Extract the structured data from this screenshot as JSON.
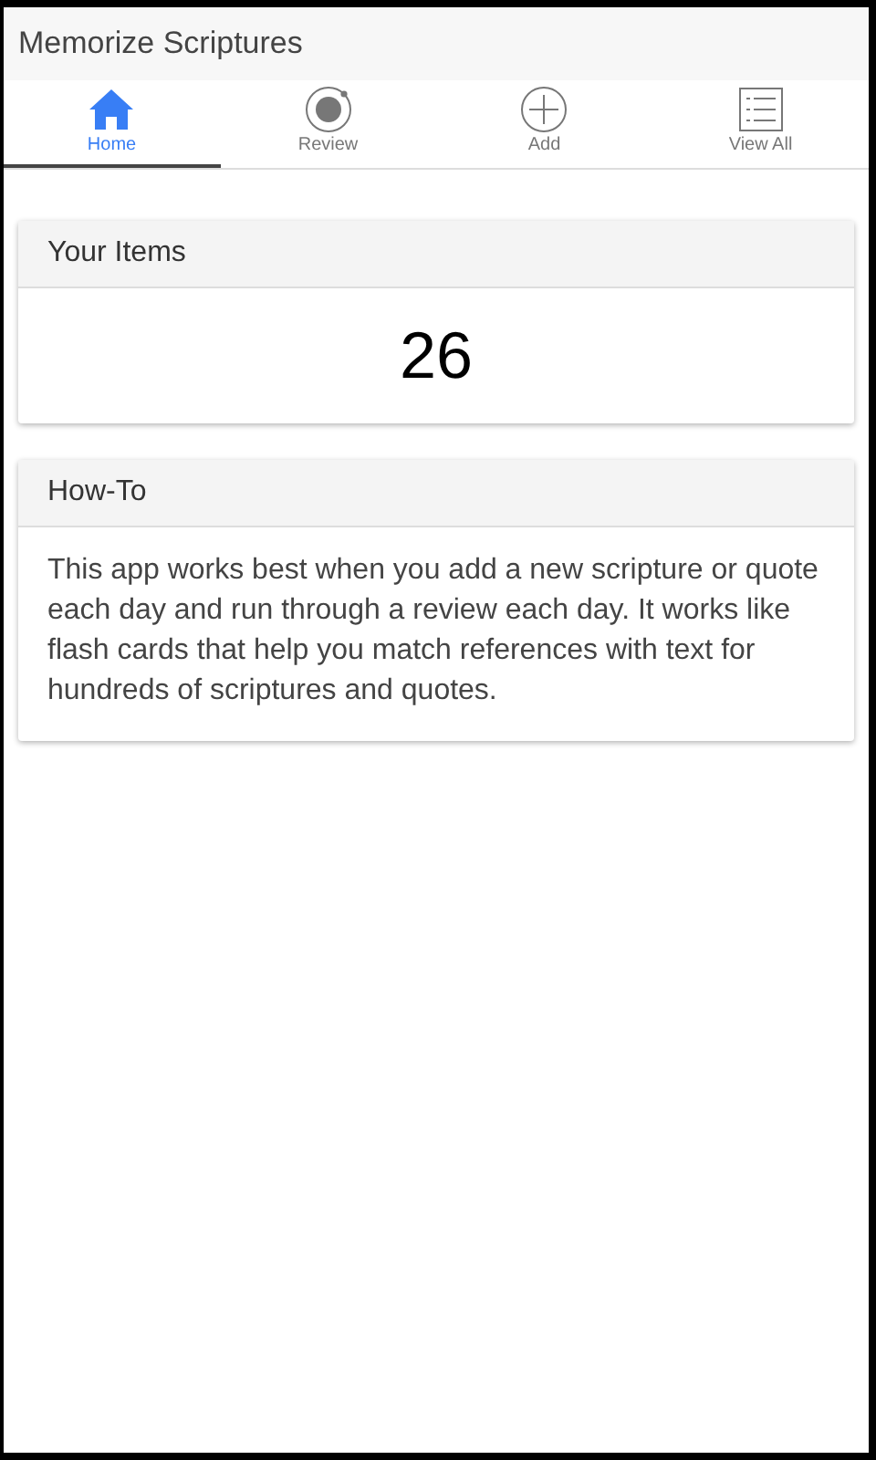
{
  "header": {
    "title": "Memorize Scriptures"
  },
  "tabs": [
    {
      "kind": "home",
      "label": "Home",
      "selected": true
    },
    {
      "kind": "review",
      "label": "Review",
      "selected": false
    },
    {
      "kind": "add",
      "label": "Add",
      "selected": false
    },
    {
      "kind": "list",
      "label": "View All",
      "selected": false
    }
  ],
  "cards": [
    {
      "kind": "count",
      "title": "Your Items",
      "body": "26"
    },
    {
      "kind": "text",
      "title": "How-To",
      "body": "This app works best when you add a new scripture or quote each day and run through a review each day. It works like flash cards that help you match references with text for hundreds of scriptures and quotes."
    }
  ]
}
